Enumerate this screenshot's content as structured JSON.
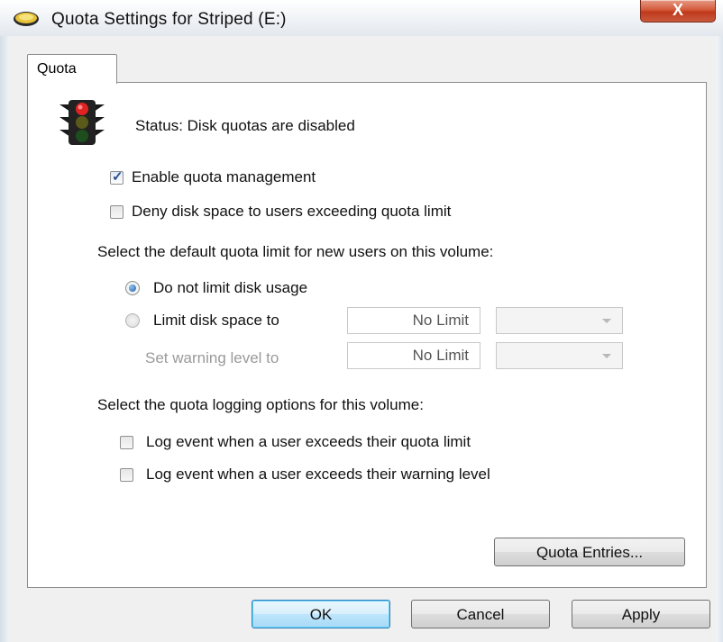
{
  "window": {
    "title": "Quota Settings for Striped (E:)",
    "close_glyph": "X"
  },
  "tabs": [
    {
      "label": "Quota",
      "selected": true
    }
  ],
  "status": {
    "icon": "traffic-light-icon",
    "text": "Status:  Disk quotas are disabled"
  },
  "options": {
    "enable_quota": {
      "label": "Enable quota management",
      "checked": true
    },
    "deny_space": {
      "label": "Deny disk space to users exceeding quota limit",
      "checked": false
    }
  },
  "default_limit": {
    "heading": "Select the default quota limit for new users on this volume:",
    "no_limit_radio": {
      "label": "Do not limit disk usage",
      "selected": true
    },
    "limit_radio": {
      "label": "Limit disk space to",
      "selected": false
    },
    "limit_value": "No Limit",
    "warning_label": "Set warning level to",
    "warning_value": "No Limit"
  },
  "logging": {
    "heading": "Select the quota logging options for this volume:",
    "log_limit": {
      "label": "Log event when a user exceeds their quota limit",
      "checked": false
    },
    "log_warning": {
      "label": "Log event when a user exceeds their warning level",
      "checked": false
    }
  },
  "buttons": {
    "quota_entries": "Quota Entries...",
    "ok": "OK",
    "cancel": "Cancel",
    "apply": "Apply"
  },
  "colors": {
    "close_button": "#c8452a",
    "default_button_border": "#3c7fb1",
    "radio_selected": "#1d5aa8"
  }
}
